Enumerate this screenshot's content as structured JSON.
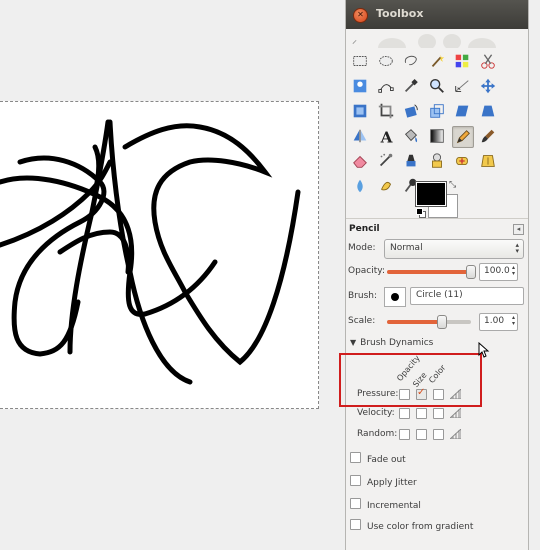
{
  "window": {
    "title": "Toolbox"
  },
  "tool_options": {
    "title": "Pencil",
    "mode": {
      "label": "Mode:",
      "value": "Normal"
    },
    "opacity": {
      "label": "Opacity:",
      "value": "100.0",
      "fraction": 1.0
    },
    "brush": {
      "label": "Brush:",
      "value": "Circle (11)"
    },
    "scale": {
      "label": "Scale:",
      "value": "1.00",
      "fraction": 0.6
    },
    "brush_dynamics": {
      "label": "Brush Dynamics",
      "columns": [
        "Opacity",
        "Size",
        "Color"
      ],
      "rows": [
        {
          "label": "Pressure:",
          "checked": [
            false,
            true,
            false
          ]
        },
        {
          "label": "Velocity:",
          "checked": [
            false,
            false,
            false
          ]
        },
        {
          "label": "Random:",
          "checked": [
            false,
            false,
            false
          ]
        }
      ]
    },
    "checkboxes": [
      {
        "label": "Fade out",
        "checked": false
      },
      {
        "label": "Apply Jitter",
        "checked": false
      },
      {
        "label": "Incremental",
        "checked": false
      },
      {
        "label": "Use color from gradient",
        "checked": false
      }
    ]
  },
  "tools": [
    "rect-select-icon",
    "ellipse-select-icon",
    "free-select-icon",
    "fuzzy-select-icon",
    "select-by-color-icon",
    "scissors-icon",
    "foreground-select-icon",
    "paths-icon",
    "color-picker-icon",
    "zoom-icon",
    "measure-icon",
    "move-icon",
    "align-icon",
    "crop-icon",
    "rotate-icon",
    "scale-icon",
    "shear-icon",
    "perspective-icon",
    "flip-icon",
    "text-icon",
    "bucket-fill-icon",
    "blend-icon",
    "pencil-icon",
    "paintbrush-icon",
    "eraser-icon",
    "airbrush-icon",
    "ink-icon",
    "clone-icon",
    "heal-icon",
    "perspective-clone-icon",
    "blur-icon",
    "smudge-icon",
    "dodge-burn-icon"
  ],
  "colors": {
    "foreground": "#000000",
    "background": "#ffffff",
    "accent": "#e2643a",
    "highlight": "#d01d1d"
  }
}
